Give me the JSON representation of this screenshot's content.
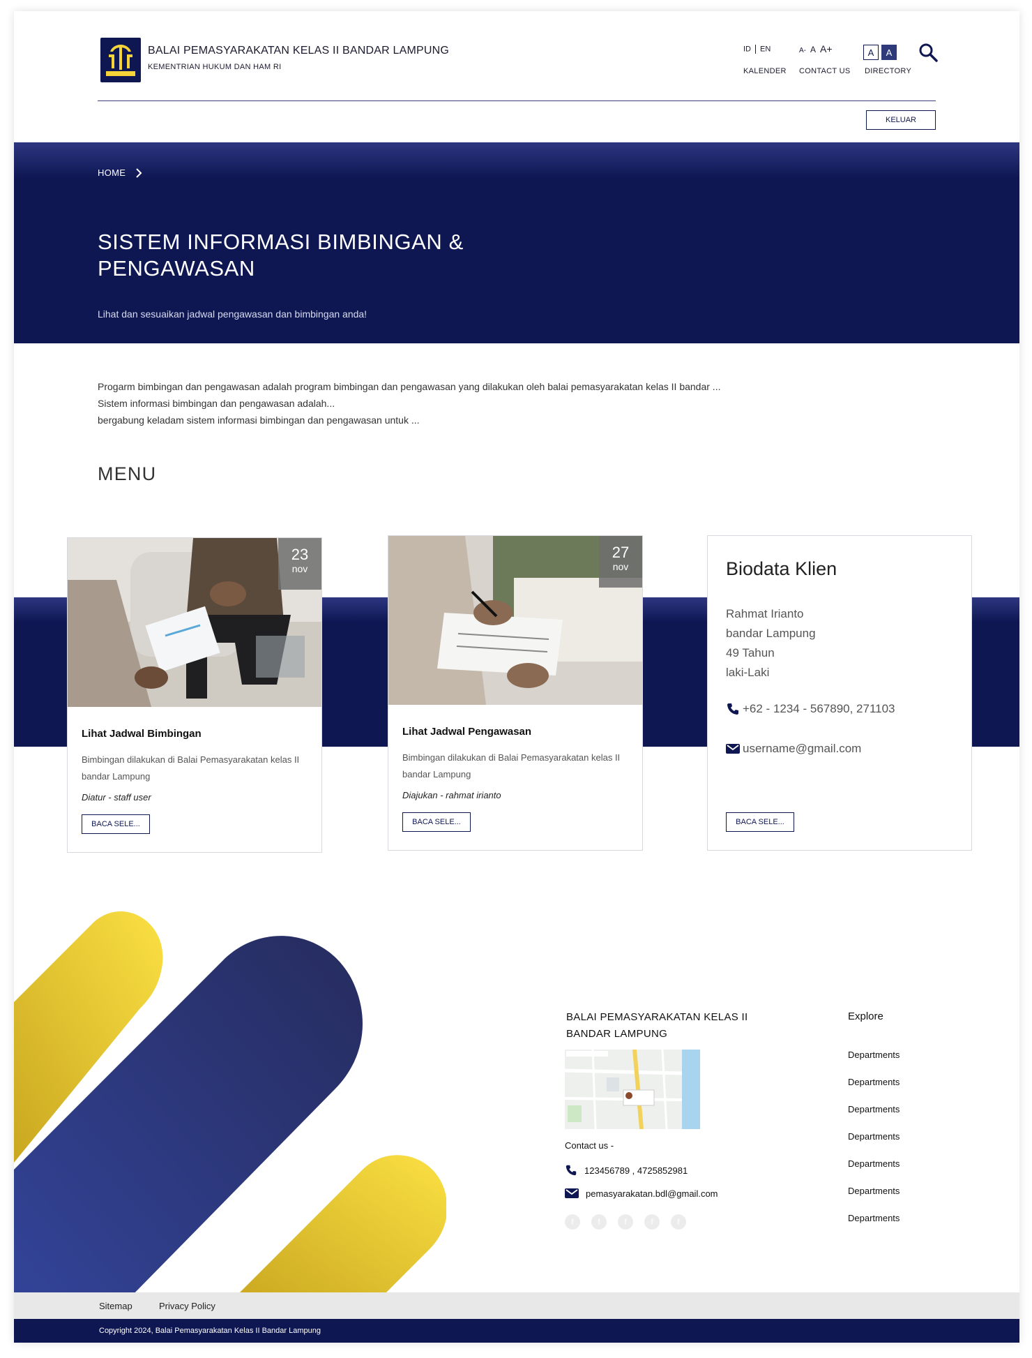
{
  "header": {
    "title": "BALAI PEMASYARAKATAN KELAS II BANDAR LAMPUNG",
    "subtitle": "KEMENTRIAN HUKUM DAN HAM RI",
    "logo_text": "PENGAYOMAN",
    "lang_id": "ID",
    "lang_en": "EN",
    "font_small": "A-",
    "font_normal": "A",
    "font_large": "A+",
    "contrast_light": "A",
    "contrast_dark": "A",
    "link_kalender": "KALENDER",
    "link_contact": "CONTACT US",
    "link_directory": "DIRECTORY",
    "logout_label": "KELUAR"
  },
  "hero": {
    "breadcrumb": "HOME",
    "title": "SISTEM INFORMASI BIMBINGAN & PENGAWASAN",
    "subtitle": "Lihat dan sesuaikan jadwal pengawasan dan bimbingan anda!"
  },
  "intro": {
    "line1": "Progarm bimbingan dan pengawasan adalah program bimbingan dan pengawasan yang dilakukan oleh balai pemasyarakatan kelas II bandar ...",
    "line2": "Sistem informasi bimbingan dan pengawasan adalah...",
    "line3": "bergabung keladam sistem informasi bimbingan dan pengawasan untuk ..."
  },
  "menu_heading": "MENU",
  "cards": [
    {
      "day": "23",
      "month": "nov",
      "title": "Lihat Jadwal Bimbingan",
      "desc": "Bimbingan dilakukan di Balai Pemasyarakatan kelas II bandar Lampung",
      "meta": "Diatur - staff user",
      "button": "BACA SELE..."
    },
    {
      "day": "27",
      "month": "nov",
      "title": "Lihat Jadwal Pengawasan",
      "desc": "Bimbingan dilakukan di Balai Pemasyarakatan kelas II bandar Lampung",
      "meta": "Diajukan - rahmat irianto",
      "button": "BACA SELE..."
    }
  ],
  "biodata": {
    "title": "Biodata Klien",
    "name": "Rahmat Irianto",
    "city": "bandar Lampung",
    "age": "49 Tahun",
    "gender": "laki-Laki",
    "phone": "+62 - 1234 - 567890, 271103",
    "email": "username@gmail.com",
    "button": "BACA SELE..."
  },
  "footer": {
    "org": "BALAI PEMASYARAKATAN KELAS II BANDAR LAMPUNG",
    "contact_label": "Contact us -",
    "phone": "123456789 , 4725852981",
    "email": "pemasyarakatan.bdl@gmail.com",
    "explore_title": "Explore",
    "explore": [
      "Departments",
      "Departments",
      "Departments",
      "Departments",
      "Departments",
      "Departments",
      "Departments"
    ],
    "sitemap": "Sitemap",
    "privacy": "Privacy Policy",
    "copyright": "Copyright 2024, Balai Pemasyarakatan Kelas II Bandar Lampung"
  },
  "colors": {
    "navy": "#0e1752",
    "gold": "#f5d43a",
    "footer_blue": "#2e3a8c"
  }
}
